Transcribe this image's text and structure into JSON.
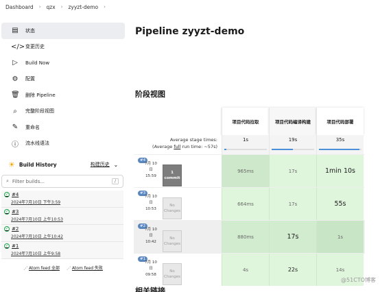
{
  "breadcrumb": [
    "Dashboard",
    "qzx",
    "zyyzt-demo"
  ],
  "sidebar": {
    "tasks": [
      {
        "label": "状态",
        "icon": "document-icon"
      },
      {
        "label": "变更历史",
        "icon": "code-icon"
      },
      {
        "label": "Build Now",
        "icon": "play-icon"
      },
      {
        "label": "配置",
        "icon": "gear-icon"
      },
      {
        "label": "删除 Pipeline",
        "icon": "trash-icon"
      },
      {
        "label": "完整阶段视图",
        "icon": "search-icon"
      },
      {
        "label": "重命名",
        "icon": "pencil-icon"
      },
      {
        "label": "流水线语法",
        "icon": "help-icon"
      }
    ]
  },
  "build_history": {
    "title": "Build History",
    "trend": "构建历史",
    "filter_placeholder": "Filter builds...",
    "filter_key": "/",
    "builds": [
      {
        "num": "#4",
        "date": "2024年7月10日 下午3:59"
      },
      {
        "num": "#3",
        "date": "2024年7月10日 上午10:53"
      },
      {
        "num": "#2",
        "date": "2024年7月10日 上午10:42"
      },
      {
        "num": "#1",
        "date": "2024年7月10日 上午9:58"
      }
    ],
    "feed_all": "Atom feed 全部",
    "feed_fail": "Atom feed 失败"
  },
  "page_title": "Pipeline zyyzt-demo",
  "stage_view_title": "阶段视图",
  "stage_view": {
    "stages": [
      "项目代码拉取",
      "项目代码编译构建",
      "项目代码部署"
    ],
    "avg_label_1": "Average stage times:",
    "avg_label_2a": "(Average ",
    "avg_label_2b": "full",
    "avg_label_2c": " run time: ~57s)",
    "averages": [
      "1s",
      "19s",
      "35s"
    ],
    "avg_fill": [
      0.05,
      0.5,
      0.95
    ],
    "runs": [
      {
        "badge": "#4",
        "month": "7月 10",
        "day": "日",
        "time": "15:59",
        "changes": "1 commit",
        "times": [
          "965ms",
          "17s",
          "1min 10s"
        ]
      },
      {
        "badge": "#3",
        "month": "7月 10",
        "day": "日",
        "time": "10:53",
        "changes": "No Changes",
        "times": [
          "664ms",
          "17s",
          "55s"
        ]
      },
      {
        "badge": "#2",
        "month": "7月 10",
        "day": "日",
        "time": "10:42",
        "changes": "No Changes",
        "times": [
          "880ms",
          "17s",
          "1s"
        ]
      },
      {
        "badge": "#1",
        "month": "7月 10",
        "day": "日",
        "time": "09:58",
        "changes": "No Changes",
        "times": [
          "4s",
          "22s",
          "14s"
        ]
      }
    ]
  },
  "related_title": "相关链接",
  "watermark": "@51CTO博客",
  "colors": {
    "success_green": "#1ea54c",
    "stage_cell": "#dff5dc",
    "badge_blue": "#5b87c0"
  }
}
